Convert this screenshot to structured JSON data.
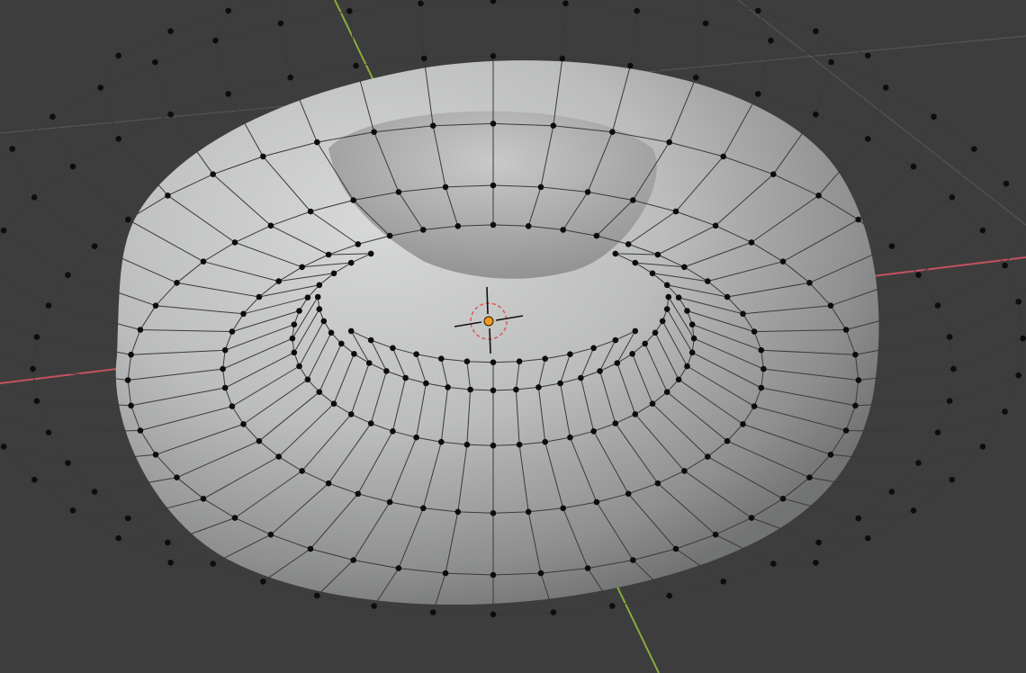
{
  "viewport": {
    "background": "#3d3d3d",
    "grid_color": "#545454",
    "axis_x_color": "#c5525e",
    "axis_y_color": "#8aac3a",
    "cursor_ring_color": "#d9534f",
    "origin_color": "#f29a1f"
  },
  "mesh": {
    "name": "torus",
    "mode": "edit",
    "surface_color": "#b9b9b9",
    "edge_color": "#3a3a3a",
    "vertex_color": "#0d0d0d",
    "major_segments": 48,
    "minor_segments": 12,
    "vertex_count": 576
  },
  "icons": {
    "cursor": "3d-cursor-icon",
    "origin": "object-origin-icon"
  }
}
